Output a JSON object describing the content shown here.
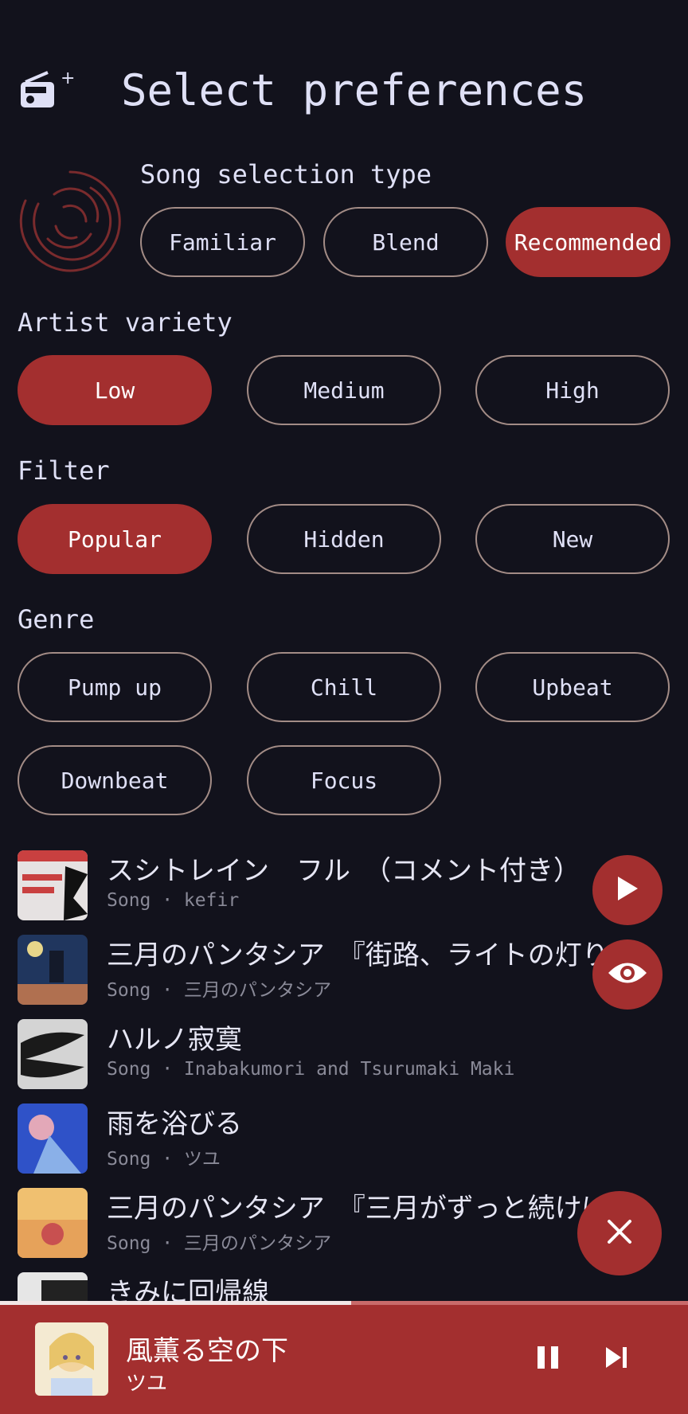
{
  "header": {
    "title": "Select preferences",
    "icon": "radio-add-icon"
  },
  "song_selection": {
    "label": "Song selection type",
    "options": [
      "Familiar",
      "Blend",
      "Recommended"
    ],
    "selected": "Recommended"
  },
  "artist_variety": {
    "label": "Artist variety",
    "options": [
      "Low",
      "Medium",
      "High"
    ],
    "selected": "Low"
  },
  "filter": {
    "label": "Filter",
    "options": [
      "Popular",
      "Hidden",
      "New"
    ],
    "selected": "Popular"
  },
  "genre": {
    "label": "Genre",
    "options": [
      "Pump up",
      "Chill",
      "Upbeat",
      "Downbeat",
      "Focus"
    ]
  },
  "songs": [
    {
      "title": "スシトレイン　フル　（コメント付き）",
      "subtitle": "Song · kefir"
    },
    {
      "title": "三月のパンタシア　『街路、ライトの灯り』",
      "subtitle": "Song · 三月のパンタシア"
    },
    {
      "title": "ハルノ寂寞",
      "subtitle": "Song · Inabakumori and Tsurumaki Maki"
    },
    {
      "title": "雨を浴びる",
      "subtitle": "Song · ツユ"
    },
    {
      "title": "三月のパンタシア　『三月がずっと続けば』",
      "subtitle": "Song · 三月のパンタシア"
    },
    {
      "title": "きみに回帰線",
      "subtitle": ""
    }
  ],
  "now_playing": {
    "title": "風薫る空の下",
    "artist": "ツユ",
    "progress": 0.51
  },
  "colors": {
    "accent": "#a32f2f",
    "background": "#12121c",
    "chip_border": "#a38c86"
  }
}
